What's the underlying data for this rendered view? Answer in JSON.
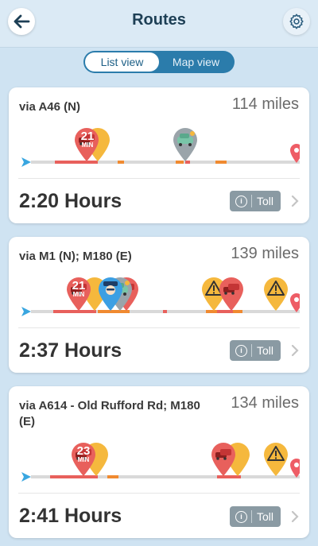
{
  "header": {
    "title": "Routes"
  },
  "view_toggle": {
    "list_label": "List view",
    "map_label": "Map view",
    "selected": "List view"
  },
  "colors": {
    "traffic_red": "#e8605c",
    "hazard_yellow": "#f5b83d",
    "slow_orange": "#f08a30",
    "police_blue": "#3c9fe3",
    "start_blue": "#39a6e0",
    "dest_red": "#ee5d66",
    "toll_grey": "#8a9aa3"
  },
  "routes": [
    {
      "via": "via A46 (N)",
      "distance": "114 miles",
      "delay": {
        "value": "21",
        "unit": "MIN"
      },
      "duration": "2:20 Hours",
      "toll_label": "Toll",
      "alerts": [
        "traffic-jam",
        "hazard",
        "stopped-car"
      ]
    },
    {
      "via": "via M1 (N); M180 (E)",
      "distance": "139 miles",
      "delay": {
        "value": "21",
        "unit": "MIN"
      },
      "duration": "2:37 Hours",
      "toll_label": "Toll",
      "alerts": [
        "traffic-jam",
        "police",
        "stopped-car",
        "traffic-jam",
        "hazard",
        "hazard"
      ]
    },
    {
      "via": "via A614 - Old Rufford Rd; M180 (E)",
      "distance": "134 miles",
      "delay": {
        "value": "23",
        "unit": "MIN"
      },
      "duration": "2:41 Hours",
      "toll_label": "Toll",
      "alerts": [
        "traffic-jam",
        "hazard",
        "traffic-jam",
        "hazard"
      ]
    }
  ]
}
